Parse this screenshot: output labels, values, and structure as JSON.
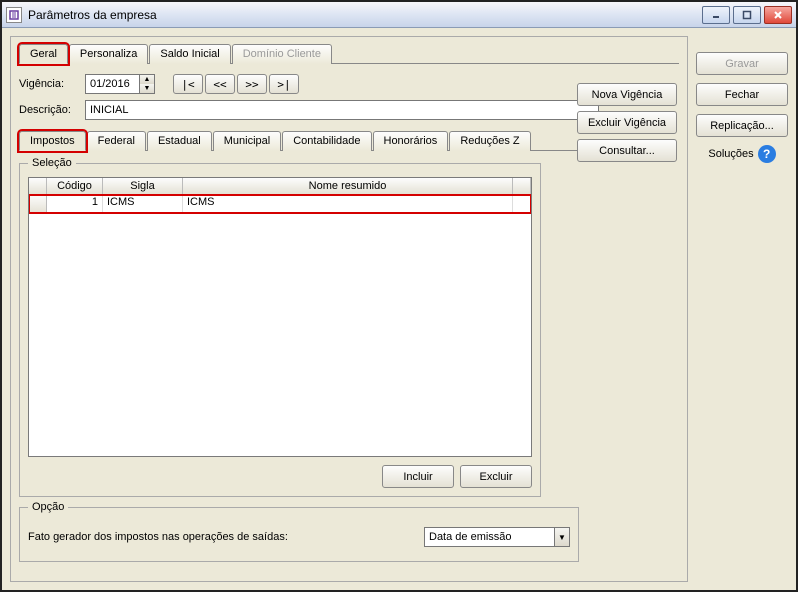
{
  "window": {
    "title": "Parâmetros da empresa"
  },
  "tabs_main": {
    "geral": "Geral",
    "personaliza": "Personaliza",
    "saldo_inicial": "Saldo Inicial",
    "dominio_cliente": "Domínio Cliente"
  },
  "vigencia": {
    "label": "Vigência:",
    "value": "01/2016",
    "nav": {
      "first": "|<",
      "prev": "<<",
      "next": ">>",
      "last": ">|"
    }
  },
  "descricao": {
    "label": "Descrição:",
    "value": "INICIAL"
  },
  "tabs_sub": {
    "impostos": "Impostos",
    "federal": "Federal",
    "estadual": "Estadual",
    "municipal": "Municipal",
    "contabilidade": "Contabilidade",
    "honorarios": "Honorários",
    "reducoes_z": "Reduções Z"
  },
  "selecao": {
    "legend": "Seleção",
    "columns": {
      "codigo": "Código",
      "sigla": "Sigla",
      "nome_resumido": "Nome resumido"
    },
    "rows": [
      {
        "codigo": "1",
        "sigla": "ICMS",
        "nome_resumido": "ICMS"
      }
    ],
    "buttons": {
      "incluir": "Incluir",
      "excluir": "Excluir"
    }
  },
  "opcao": {
    "legend": "Opção",
    "label": "Fato gerador dos impostos nas operações de saídas:",
    "value": "Data de emissão"
  },
  "side": {
    "nova_vigencia": "Nova Vigência",
    "excluir_vigencia": "Excluir Vigência",
    "consultar": "Consultar..."
  },
  "right_panel": {
    "gravar": "Gravar",
    "fechar": "Fechar",
    "replicacao": "Replicação...",
    "solucoes": "Soluções"
  }
}
